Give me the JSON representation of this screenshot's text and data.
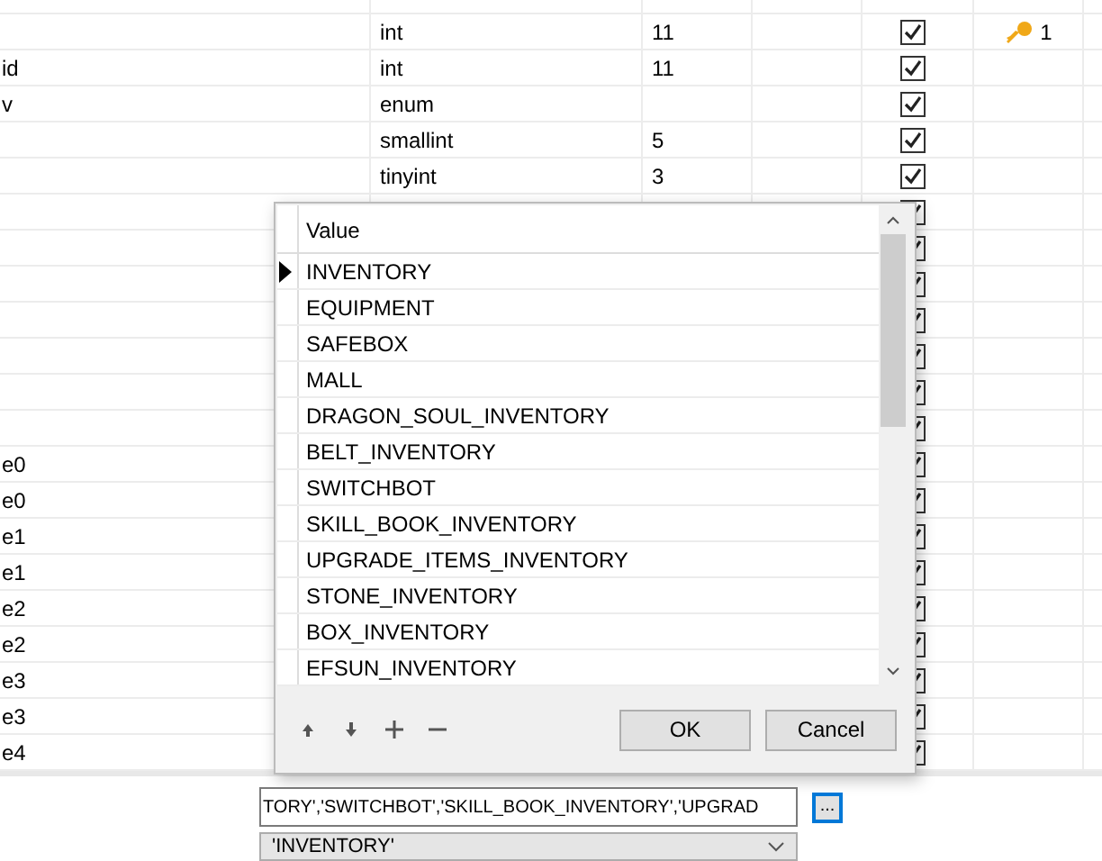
{
  "table": {
    "rows": [
      {
        "name": "",
        "type": "int",
        "length": "11",
        "not_null": true,
        "key": "1"
      },
      {
        "name": "id",
        "type": "int",
        "length": "11",
        "not_null": true
      },
      {
        "name": "v",
        "type": "enum",
        "length": "",
        "not_null": true
      },
      {
        "name": "",
        "type": "smallint",
        "length": "5",
        "not_null": true
      },
      {
        "name": "",
        "type": "tinyint",
        "length": "3",
        "not_null": true
      },
      {
        "name": "",
        "type": "",
        "length": "",
        "not_null": true
      },
      {
        "name": "",
        "type": "",
        "length": "",
        "not_null": true
      },
      {
        "name": "",
        "type": "",
        "length": "",
        "not_null": true
      },
      {
        "name": "",
        "type": "",
        "length": "",
        "not_null": true
      },
      {
        "name": "",
        "type": "",
        "length": "",
        "not_null": true
      },
      {
        "name": "",
        "type": "",
        "length": "",
        "not_null": true
      },
      {
        "name": "",
        "type": "",
        "length": "",
        "not_null": true
      },
      {
        "name": "e0",
        "type": "",
        "length": "",
        "not_null": true
      },
      {
        "name": "e0",
        "type": "",
        "length": "",
        "not_null": true
      },
      {
        "name": "e1",
        "type": "",
        "length": "",
        "not_null": true
      },
      {
        "name": "e1",
        "type": "",
        "length": "",
        "not_null": true
      },
      {
        "name": "e2",
        "type": "",
        "length": "",
        "not_null": true
      },
      {
        "name": "e2",
        "type": "",
        "length": "",
        "not_null": true
      },
      {
        "name": "e3",
        "type": "",
        "length": "",
        "not_null": true
      },
      {
        "name": "e3",
        "type": "",
        "length": "",
        "not_null": true
      },
      {
        "name": "e4",
        "type": "",
        "length": "",
        "not_null": true
      }
    ]
  },
  "dialog": {
    "column": "Value",
    "items": [
      {
        "label": "INVENTORY",
        "selected": true
      },
      {
        "label": "EQUIPMENT",
        "selected": false
      },
      {
        "label": "SAFEBOX",
        "selected": false
      },
      {
        "label": "MALL",
        "selected": false
      },
      {
        "label": "DRAGON_SOUL_INVENTORY",
        "selected": false
      },
      {
        "label": "BELT_INVENTORY",
        "selected": false
      },
      {
        "label": "SWITCHBOT",
        "selected": false
      },
      {
        "label": "SKILL_BOOK_INVENTORY",
        "selected": false
      },
      {
        "label": "UPGRADE_ITEMS_INVENTORY",
        "selected": false
      },
      {
        "label": "STONE_INVENTORY",
        "selected": false
      },
      {
        "label": "BOX_INVENTORY",
        "selected": false
      },
      {
        "label": "EFSUN_INVENTORY",
        "selected": false
      }
    ],
    "buttons": [
      "OK",
      "Cancel"
    ]
  },
  "form": {
    "values_field": "TORY','SWITCHBOT','SKILL_BOOK_INVENTORY','UPGRAD",
    "browse_button": "...",
    "default_select": "'INVENTORY'"
  }
}
